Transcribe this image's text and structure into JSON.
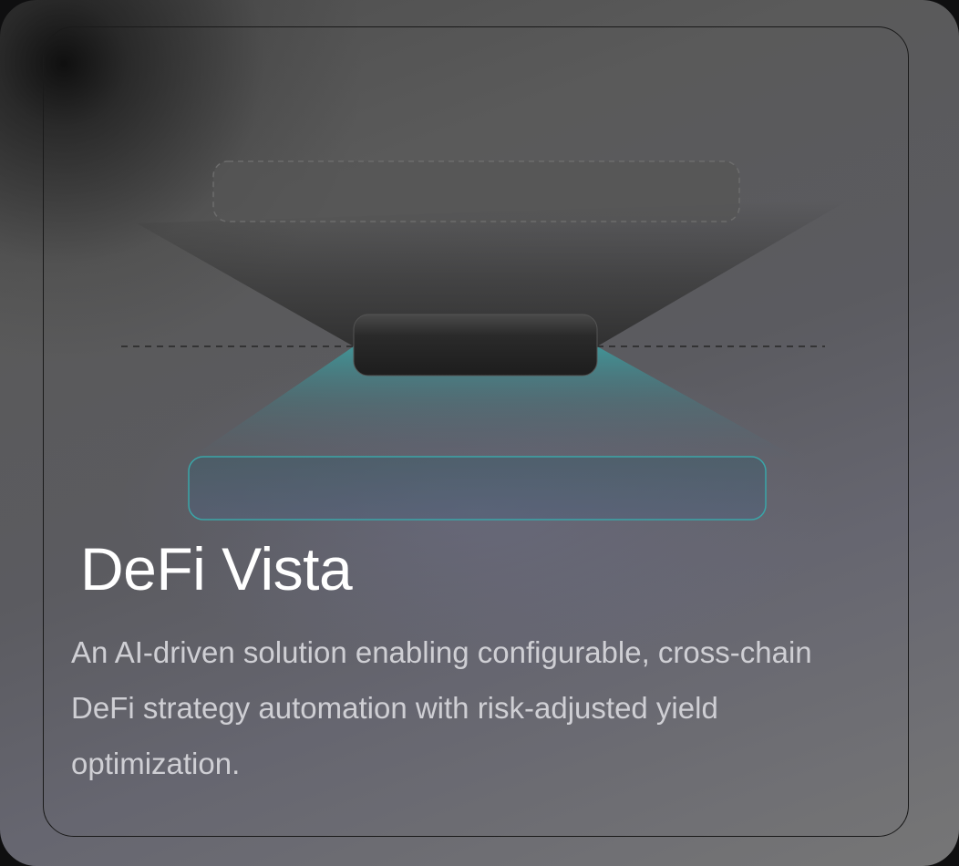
{
  "card": {
    "title": "DeFi Vista",
    "description": "An AI-driven solution enabling configurable, cross-chain DeFi strategy automation with risk-adjusted yield optimization."
  },
  "colors": {
    "accent": "#3aa5a8",
    "title_text": "#ffffff",
    "description_text": "#cfcfd4",
    "frame_border": "#1a1a1a"
  },
  "illustration": {
    "top_box_style": "dashed",
    "middle_pill_style": "dark",
    "bottom_box_style": "teal-outline",
    "divider_style": "dashed"
  }
}
